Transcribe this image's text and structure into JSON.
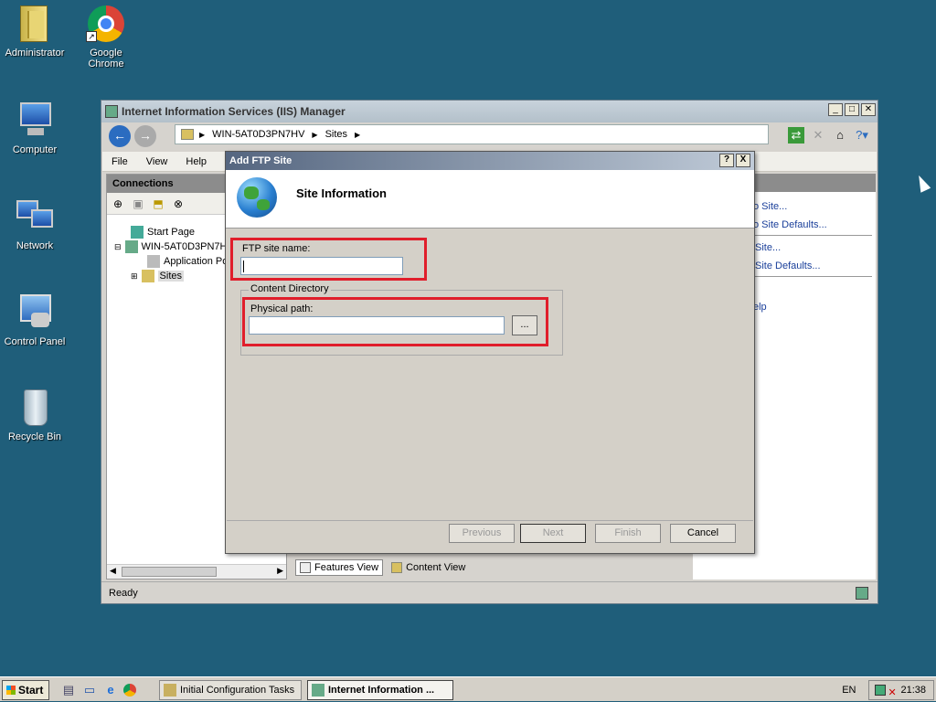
{
  "desktop": {
    "icons": [
      {
        "label": "Administrator"
      },
      {
        "label": "Google Chrome"
      },
      {
        "label": "Computer"
      },
      {
        "label": "Network"
      },
      {
        "label": "Control Panel"
      },
      {
        "label": "Recycle Bin"
      }
    ]
  },
  "iis_window": {
    "title": "Internet Information Services (IIS) Manager",
    "breadcrumb": [
      "WIN-5AT0D3PN7HV",
      "Sites"
    ],
    "menu": [
      "File",
      "View",
      "Help"
    ],
    "connections": {
      "header": "Connections",
      "tree": [
        {
          "label": "Start Page"
        },
        {
          "label": "WIN-5AT0D3PN7H"
        },
        {
          "label": "Application Po"
        },
        {
          "label": "Sites"
        }
      ]
    },
    "actions": {
      "links": [
        "o Site...",
        "o Site Defaults...",
        "Site...",
        "Site Defaults...",
        "elp"
      ]
    },
    "views": {
      "features": "Features View",
      "content": "Content View"
    },
    "status": "Ready"
  },
  "dialog": {
    "title": "Add FTP Site",
    "help_btn": "?",
    "close_btn": "X",
    "heading": "Site Information",
    "ftp_site_name": {
      "label": "FTP site name:",
      "value": ""
    },
    "content_directory": {
      "legend": "Content Directory",
      "physical_path": {
        "label": "Physical path:",
        "value": ""
      },
      "browse_label": "..."
    },
    "buttons": {
      "previous": "Previous",
      "next": "Next",
      "finish": "Finish",
      "cancel": "Cancel"
    },
    "highlight_color": "#e01e2b"
  },
  "taskbar": {
    "start": "Start",
    "tasks": [
      {
        "label": "Initial Configuration Tasks",
        "active": false
      },
      {
        "label": "Internet Information ...",
        "active": true
      }
    ],
    "language": "EN",
    "clock": "21:38"
  }
}
